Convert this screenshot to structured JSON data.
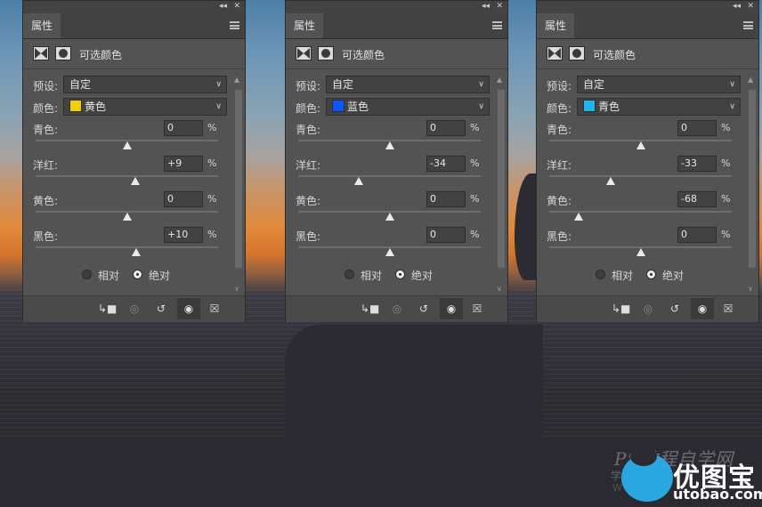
{
  "colors": {
    "panel_bg": "#535353",
    "field_bg": "#424242",
    "yellow": "#f2d100",
    "blue": "#0a57ff",
    "cyan": "#23b3ef"
  },
  "panels": [
    {
      "tab_label": "属性",
      "adjustment_title": "可选颜色",
      "preset_label": "预设:",
      "preset_value": "自定",
      "colors_label": "颜色:",
      "color_value": "黄色",
      "color_swatch": "yellow",
      "sliders": [
        {
          "label": "青色:",
          "value": "0",
          "unit": "%",
          "position": 0.5
        },
        {
          "label": "洋红:",
          "value": "+9",
          "unit": "%",
          "position": 0.545
        },
        {
          "label": "黄色:",
          "value": "0",
          "unit": "%",
          "position": 0.5
        },
        {
          "label": "黑色:",
          "value": "+10",
          "unit": "%",
          "position": 0.55
        }
      ],
      "radio_relative": "相对",
      "radio_absolute": "绝对",
      "selected_method": "absolute"
    },
    {
      "tab_label": "属性",
      "adjustment_title": "可选颜色",
      "preset_label": "预设:",
      "preset_value": "自定",
      "colors_label": "颜色:",
      "color_value": "蓝色",
      "color_swatch": "blue",
      "sliders": [
        {
          "label": "青色:",
          "value": "0",
          "unit": "%",
          "position": 0.5
        },
        {
          "label": "洋红:",
          "value": "-34",
          "unit": "%",
          "position": 0.33
        },
        {
          "label": "黄色:",
          "value": "0",
          "unit": "%",
          "position": 0.5
        },
        {
          "label": "黑色:",
          "value": "0",
          "unit": "%",
          "position": 0.5
        }
      ],
      "radio_relative": "相对",
      "radio_absolute": "绝对",
      "selected_method": "absolute"
    },
    {
      "tab_label": "属性",
      "adjustment_title": "可选颜色",
      "preset_label": "预设:",
      "preset_value": "自定",
      "colors_label": "颜色:",
      "color_value": "青色",
      "color_swatch": "cyan",
      "sliders": [
        {
          "label": "青色:",
          "value": "0",
          "unit": "%",
          "position": 0.5
        },
        {
          "label": "洋红:",
          "value": "-33",
          "unit": "%",
          "position": 0.335
        },
        {
          "label": "黄色:",
          "value": "-68",
          "unit": "%",
          "position": 0.16
        },
        {
          "label": "黑色:",
          "value": "0",
          "unit": "%",
          "position": 0.5
        }
      ],
      "radio_relative": "相对",
      "radio_absolute": "绝对",
      "selected_method": "absolute"
    }
  ],
  "watermark": {
    "text1": "PS教程自学网",
    "text2": "学PS,就到",
    "text3": "WWW",
    "logo_name": "优图宝",
    "logo_url": "utobao.com"
  }
}
